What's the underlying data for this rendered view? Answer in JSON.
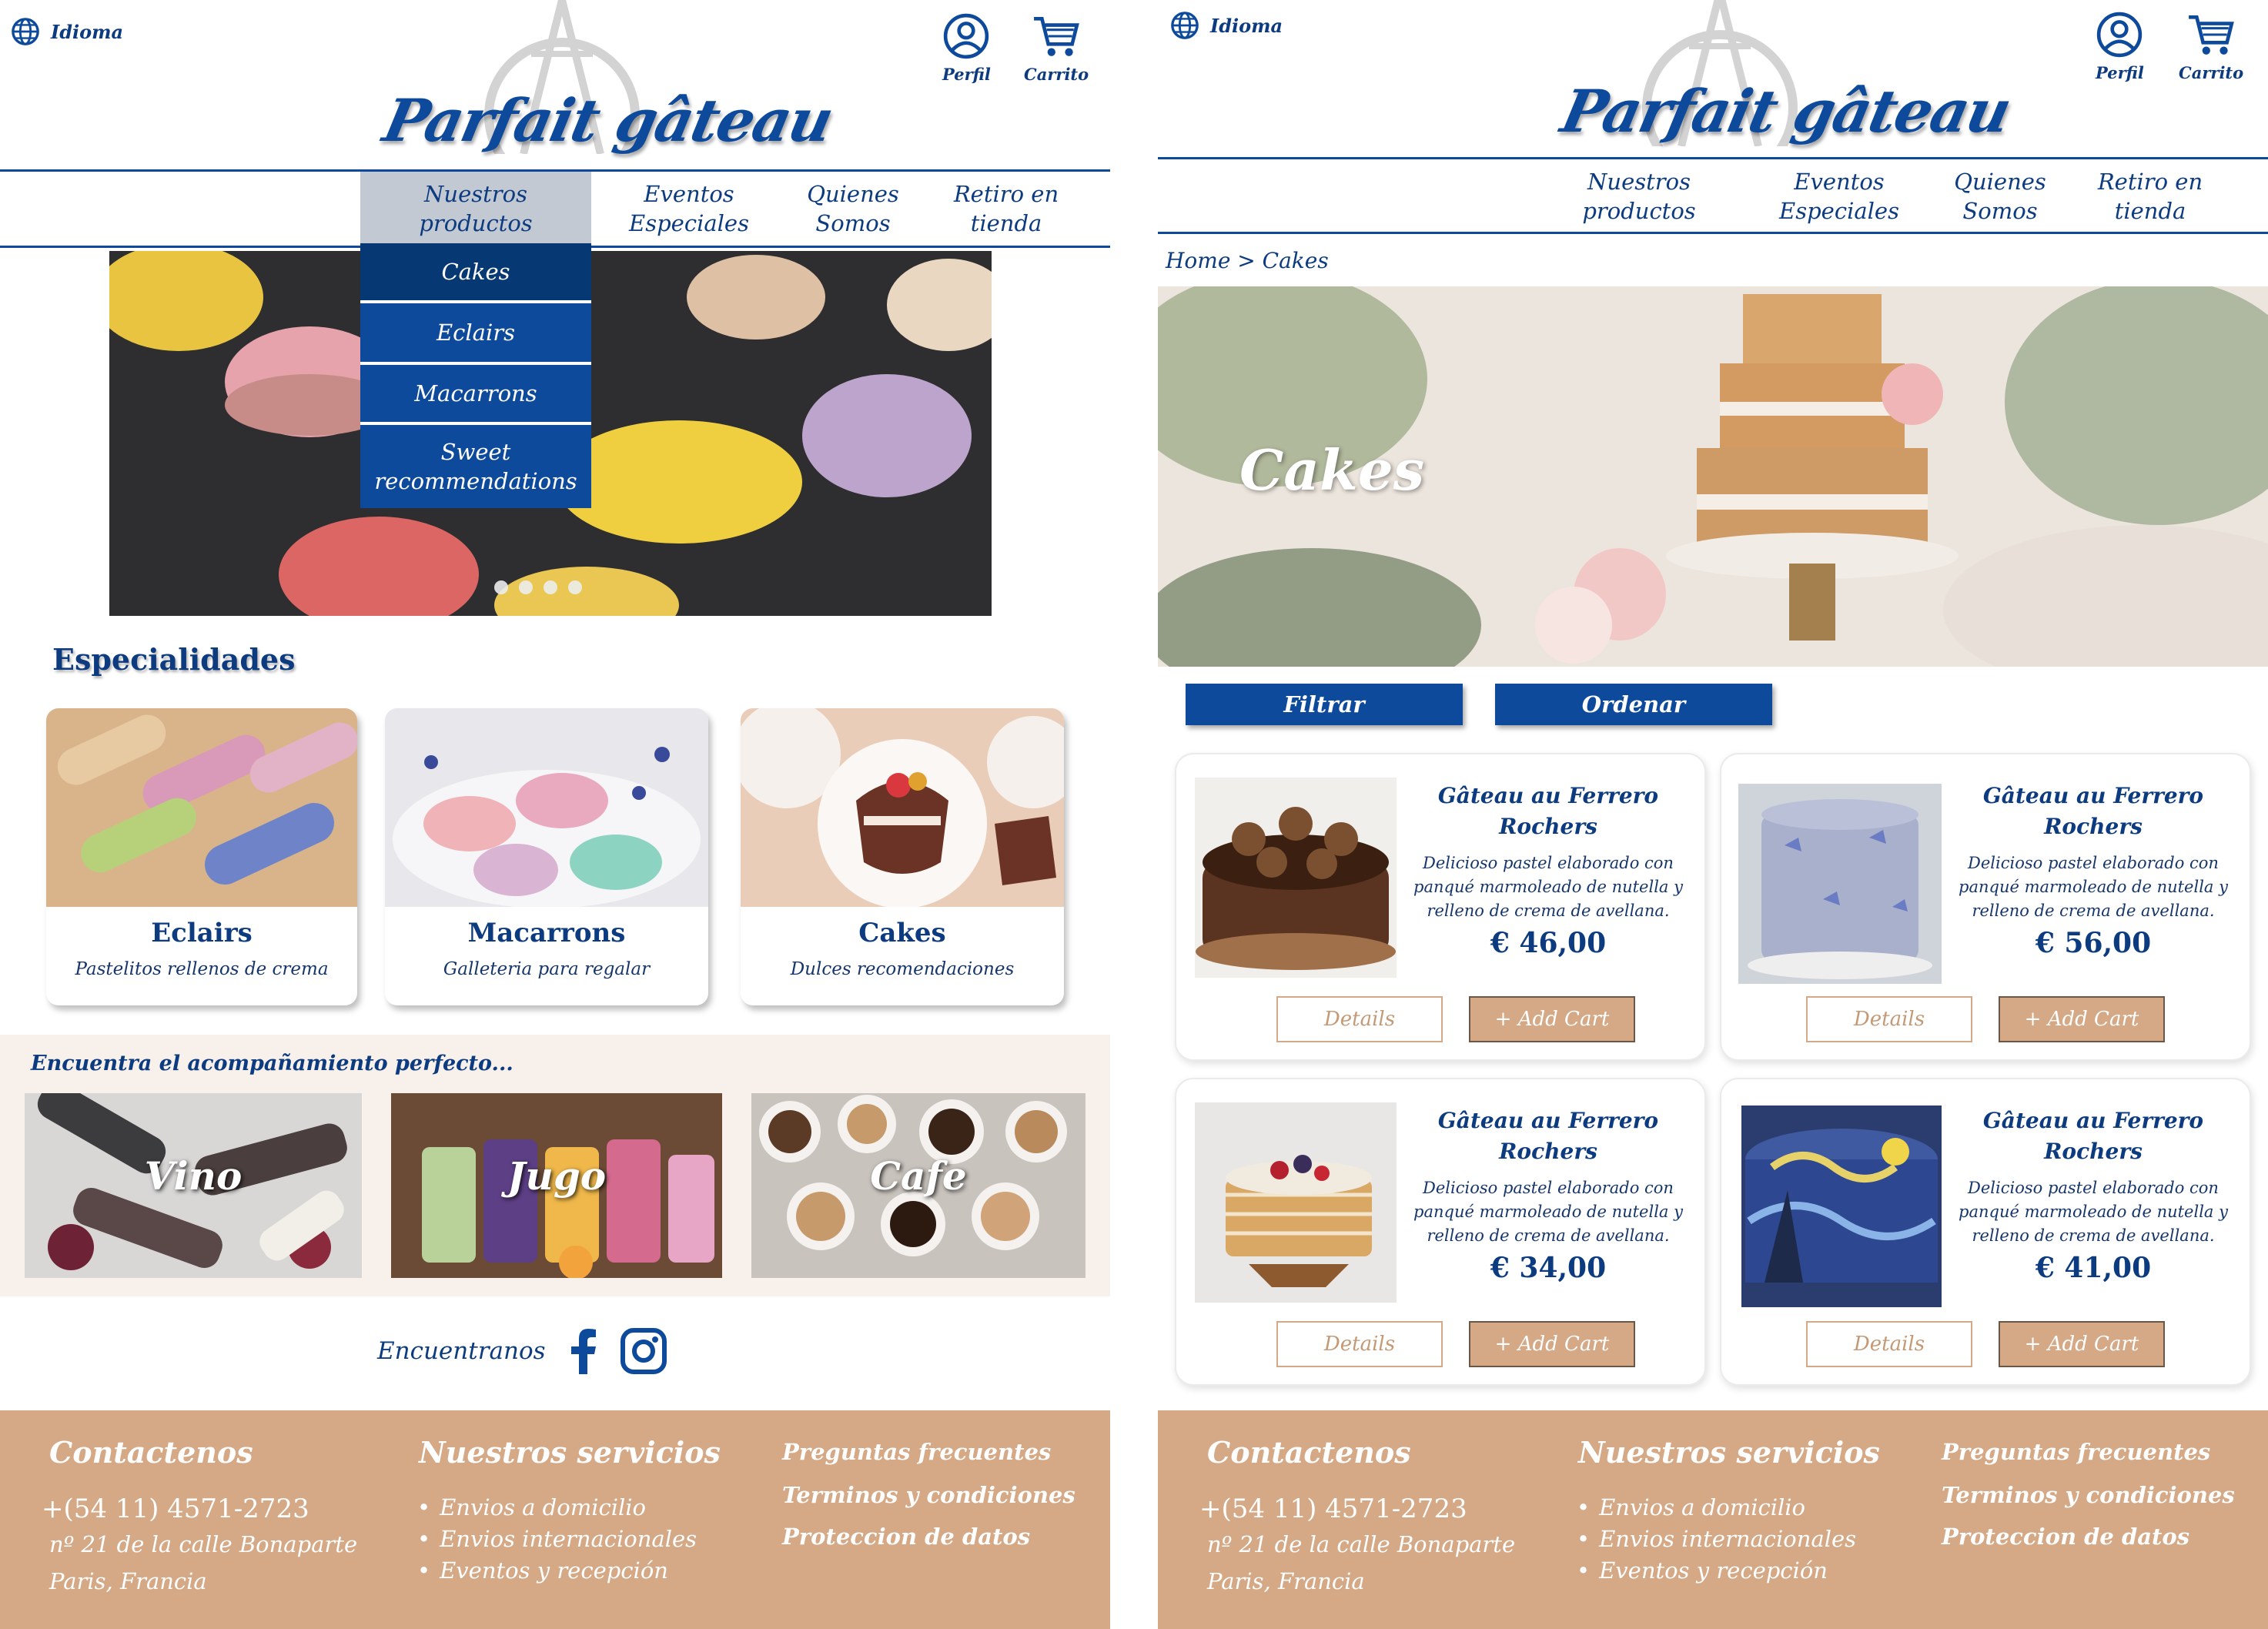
{
  "header": {
    "idioma_label": "Idioma",
    "perfil_label": "Perfil",
    "carrito_label": "Carrito",
    "logo_text": "Parfait gâteau",
    "nav": [
      {
        "line1": "Nuestros",
        "line2": "productos"
      },
      {
        "line1": "Eventos",
        "line2": "Especiales"
      },
      {
        "line1": "Quienes",
        "line2": "Somos"
      },
      {
        "line1": "Retiro en",
        "line2": "tienda"
      }
    ]
  },
  "dropdown": {
    "items": [
      {
        "line1": "Cakes",
        "line2": ""
      },
      {
        "line1": "Eclairs",
        "line2": ""
      },
      {
        "line1": "Macarrons",
        "line2": ""
      },
      {
        "line1": "Sweet",
        "line2": "recommendations"
      }
    ]
  },
  "home": {
    "especialidades_title": "Especialidades",
    "specialties": [
      {
        "title": "Eclairs",
        "subtitle": "Pastelitos rellenos de crema"
      },
      {
        "title": "Macarrons",
        "subtitle": "Galleteria para regalar"
      },
      {
        "title": "Cakes",
        "subtitle": "Dulces recomendaciones"
      }
    ],
    "acompanamiento_title": "Encuentra el acompañamiento perfecto...",
    "pairings": [
      {
        "label": "Vino"
      },
      {
        "label": "Jugo"
      },
      {
        "label": "Cafe"
      }
    ],
    "social_label": "Encuentranos"
  },
  "catalog": {
    "breadcrumb": "Home > Cakes",
    "banner_title": "Cakes",
    "filter_label": "Filtrar",
    "order_label": "Ordenar",
    "products": [
      {
        "name": "Gâteau au Ferrero Rochers",
        "desc": "Delicioso pastel elaborado con panqué marmoleado de nutella y relleno de crema de avellana.",
        "price": "€ 46,00"
      },
      {
        "name": "Gâteau au Ferrero Rochers",
        "desc": "Delicioso pastel elaborado con panqué marmoleado de nutella y relleno de crema de avellana.",
        "price": "€ 56,00"
      },
      {
        "name": "Gâteau au Ferrero Rochers",
        "desc": "Delicioso pastel elaborado con panqué marmoleado de nutella y relleno de crema de avellana.",
        "price": "€ 34,00"
      },
      {
        "name": "Gâteau au Ferrero Rochers",
        "desc": "Delicioso pastel elaborado con panqué marmoleado de nutella y relleno de crema de avellana.",
        "price": "€ 41,00"
      }
    ],
    "details_label": "Details",
    "add_cart_label": "+ Add Cart"
  },
  "footer": {
    "contact_title": "Contactenos",
    "phone": "+(54 11) 4571-2723",
    "address_line1": "nº 21 de la calle Bonaparte",
    "address_line2": "Paris, Francia",
    "services_title": "Nuestros servicios",
    "services": [
      "Envios a domicilio",
      "Envios internacionales",
      "Eventos y recepción"
    ],
    "links": [
      "Preguntas frecuentes",
      "Terminos y condiciones",
      "Proteccion de datos"
    ]
  },
  "colors": {
    "brand_blue": "#0e4a9c",
    "dark_blue": "#063873",
    "footer_tan": "#d5a886",
    "nav_active": "#c3c9d3",
    "pairing_bg": "#f8f0eb"
  },
  "icons": [
    "globe-icon",
    "profile-icon",
    "cart-icon",
    "eiffel-tower-icon",
    "facebook-icon",
    "instagram-icon"
  ]
}
